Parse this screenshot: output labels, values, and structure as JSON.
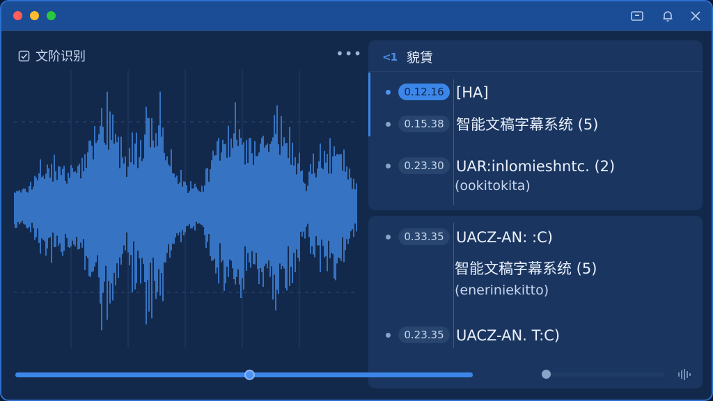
{
  "panel": {
    "title": "文阶识别",
    "more_label": "•••"
  },
  "transcript": {
    "header": "貌賃",
    "back_label": "<1",
    "entries": [
      {
        "time": "0.12.16",
        "text": "[HA]",
        "sub": "",
        "active": true
      },
      {
        "time": "0.15.38",
        "text": "智能文稿字幕系统 (5)",
        "sub": "",
        "active": false
      },
      {
        "time": "0.23.30",
        "text": "UAR:inlomieshntc.  (2)",
        "sub": "(ookitokita)",
        "active": false
      }
    ],
    "entries2": [
      {
        "time": "0.33.35",
        "text": "UACZ-AN: :C)",
        "sub": "",
        "active": false
      }
    ],
    "extra_lines": [
      {
        "text": "智能文稿字幕系统 (5)"
      },
      {
        "text": "(eneriniekitto)"
      }
    ],
    "entries3": [
      {
        "time": "0.23.35",
        "text": "UACZ-AN. T:C)",
        "sub": "",
        "active": false
      }
    ]
  },
  "playback": {
    "progress": 0.51,
    "progress_fill": 0.999,
    "volume": 0.0
  },
  "colors": {
    "accent": "#3b86e8",
    "titlebar": "#1b4d96",
    "panel": "#1a355f",
    "waveform": "#3f86e0"
  }
}
